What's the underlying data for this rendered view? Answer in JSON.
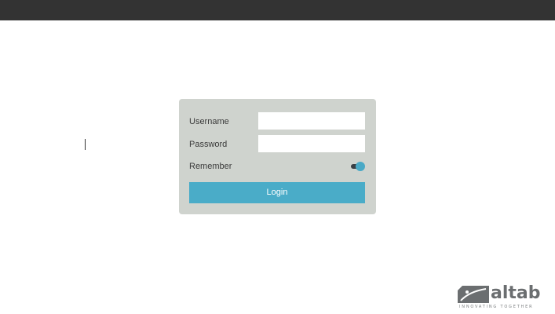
{
  "login": {
    "username_label": "Username",
    "username_value": "",
    "password_label": "Password",
    "password_value": "",
    "remember_label": "Remember",
    "remember_on": true,
    "login_button": "Login"
  },
  "brand": {
    "name": "altab",
    "tagline": "INNOVATING TOGETHER",
    "color": "#6b6e70"
  },
  "colors": {
    "top_bar": "#333333",
    "card": "#cfd3ce",
    "accent": "#4aacc8"
  }
}
